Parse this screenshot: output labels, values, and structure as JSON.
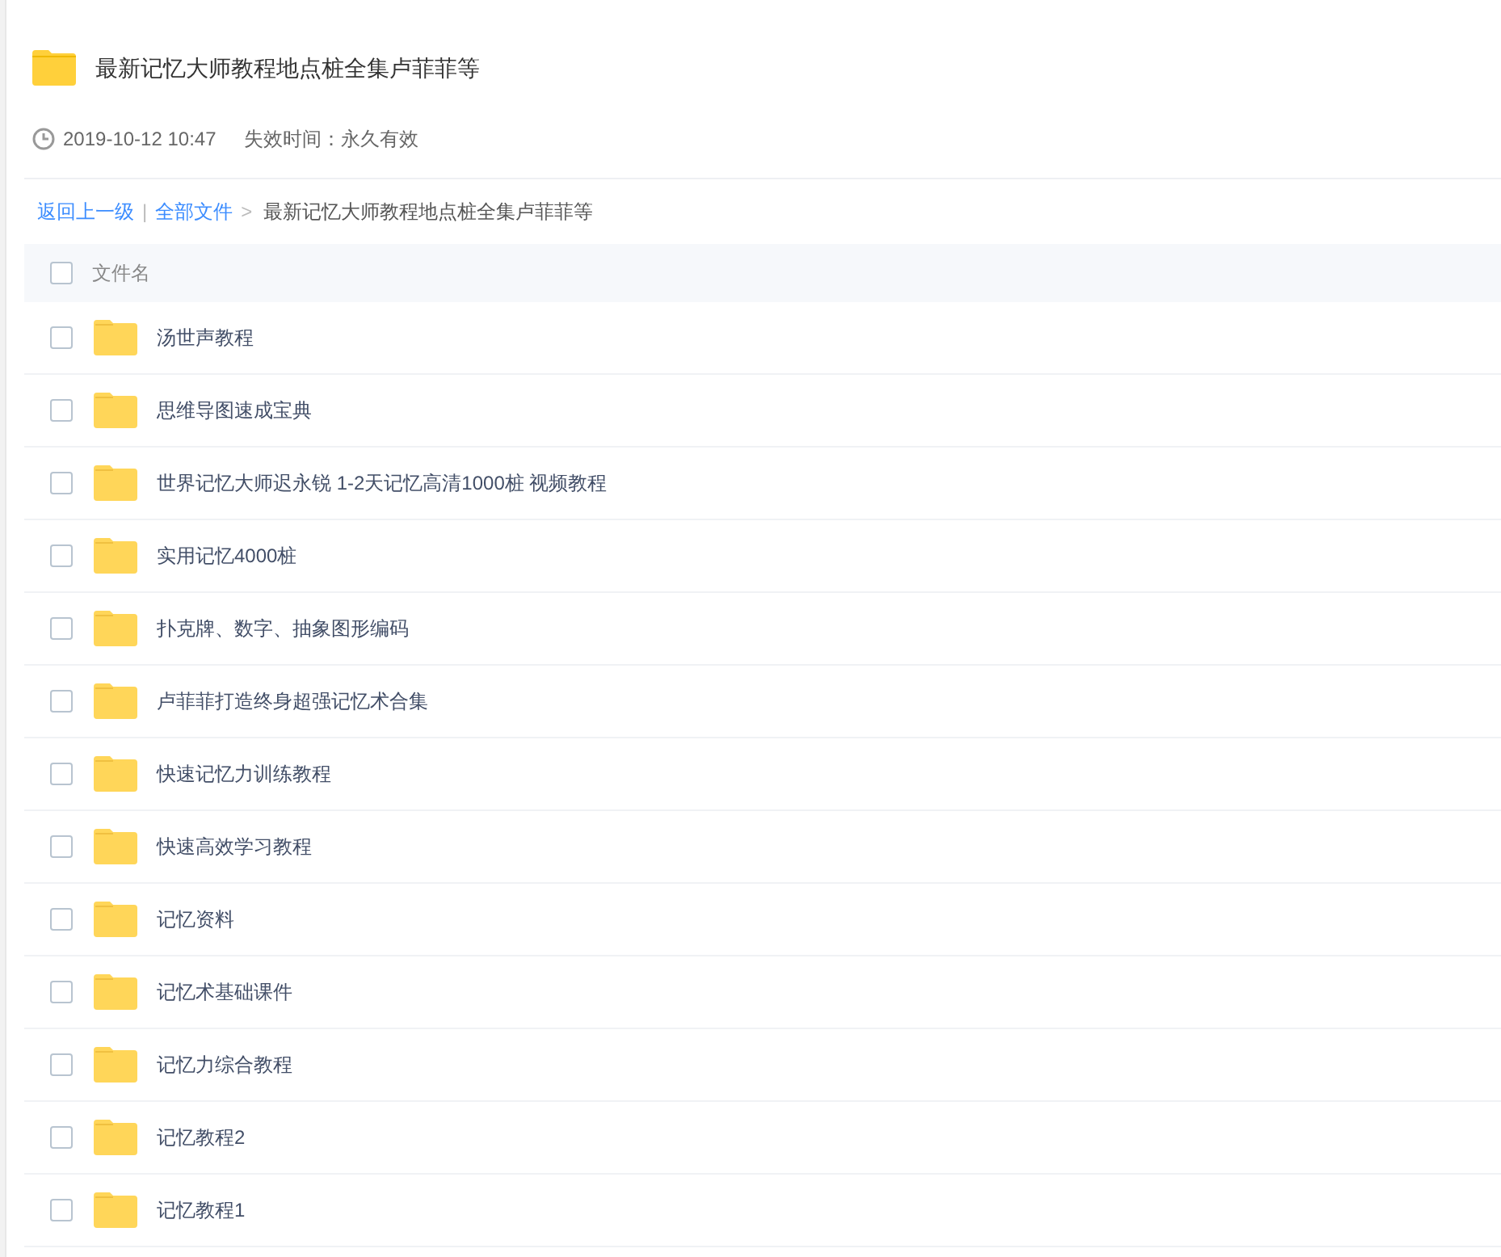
{
  "share": {
    "title": "最新记忆大师教程地点桩全集卢菲菲等",
    "time": "2019-10-12 10:47",
    "expiry": "失效时间：永久有效"
  },
  "breadcrumb": [
    {
      "label": "返回上一级",
      "kind": "link"
    },
    {
      "label": "|",
      "kind": "separator"
    },
    {
      "label": "全部文件",
      "kind": "link"
    },
    {
      "label": ">",
      "kind": "separator"
    },
    {
      "label": "最新记忆大师教程地点桩全集卢菲菲等",
      "kind": "current"
    }
  ],
  "table": {
    "header": {
      "label": "文件名",
      "checked": false
    },
    "rows": [
      {
        "name": "汤世声教程",
        "checked": false
      },
      {
        "name": "思维导图速成宝典",
        "checked": false
      },
      {
        "name": "世界记忆大师迟永锐 1-2天记忆高清1000桩 视频教程",
        "checked": false
      },
      {
        "name": "实用记忆4000桩",
        "checked": false
      },
      {
        "name": "扑克牌、数字、抽象图形编码",
        "checked": false
      },
      {
        "name": "卢菲菲打造终身超强记忆术合集",
        "checked": false
      },
      {
        "name": "快速记忆力训练教程",
        "checked": false
      },
      {
        "name": "快速高效学习教程",
        "checked": false
      },
      {
        "name": "记忆资料",
        "checked": false
      },
      {
        "name": "记忆术基础课件",
        "checked": false
      },
      {
        "name": "记忆力综合教程",
        "checked": false
      },
      {
        "name": "记忆教程2",
        "checked": false
      },
      {
        "name": "记忆教程1",
        "checked": false
      }
    ]
  }
}
